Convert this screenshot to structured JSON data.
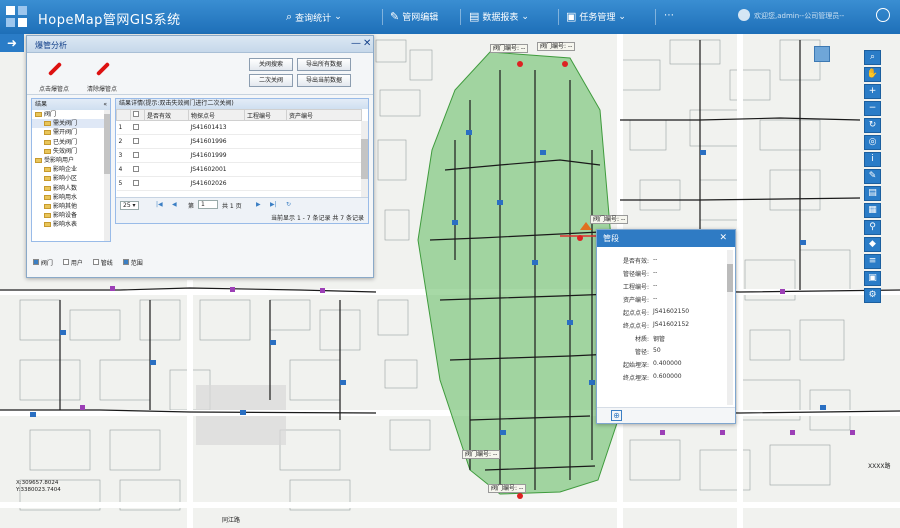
{
  "app": {
    "title": "HopeMap管网GIS系统"
  },
  "nav": [
    {
      "label": "查询统计",
      "icon": "search-icon",
      "dropdown": true
    },
    {
      "label": "管网编辑",
      "icon": "edit-icon",
      "dropdown": false
    },
    {
      "label": "数据报表",
      "icon": "report-icon",
      "dropdown": true
    },
    {
      "label": "任务管理",
      "icon": "task-icon",
      "dropdown": true
    }
  ],
  "user": {
    "text": "欢迎您,admin--公司管理员--"
  },
  "panel": {
    "title": "爆管分析",
    "tools": [
      "点击爆管点",
      "清除爆管点"
    ],
    "buttons": [
      "关阀搜索",
      "导出所有数据",
      "二次关阀",
      "导出当前数据"
    ],
    "tree": {
      "header": "结果",
      "items": [
        {
          "label": "阀门",
          "level": 0
        },
        {
          "label": "需关阀门",
          "level": 1
        },
        {
          "label": "需开阀门",
          "level": 1
        },
        {
          "label": "已关阀门",
          "level": 1
        },
        {
          "label": "失效阀门",
          "level": 1
        },
        {
          "label": "受影响用户",
          "level": 0
        },
        {
          "label": "影响企业",
          "level": 1
        },
        {
          "label": "影响小区",
          "level": 1
        },
        {
          "label": "影响人数",
          "level": 1
        },
        {
          "label": "影响用水",
          "level": 1
        },
        {
          "label": "影响其他",
          "level": 1
        },
        {
          "label": "影响设备",
          "level": 1
        },
        {
          "label": "影响水表",
          "level": 1
        }
      ]
    },
    "grid": {
      "title": "结果详情(提示:双击失效阀门进行二次关阀)",
      "columns": [
        "",
        "",
        "是否有效",
        "物探点号",
        "工程编号",
        "资产编号"
      ],
      "rows": [
        {
          "num": "1",
          "point": "JS41601413"
        },
        {
          "num": "2",
          "point": "JS41601996"
        },
        {
          "num": "3",
          "point": "JS41601999"
        },
        {
          "num": "4",
          "point": "JS41602001"
        },
        {
          "num": "5",
          "point": "JS41602026"
        }
      ],
      "pager": {
        "page_size": "25",
        "page_label": "第",
        "page": "1",
        "total_pages": "共 1 页",
        "info": "当前显示 1 - 7 条记录 共 7 条记录"
      }
    },
    "legend": [
      "阀门",
      "用户",
      "管线",
      "范围"
    ]
  },
  "popup": {
    "title": "管段",
    "rows": [
      {
        "k": "是否有效:",
        "v": "--"
      },
      {
        "k": "管径编号:",
        "v": "--"
      },
      {
        "k": "工程编号:",
        "v": "--"
      },
      {
        "k": "资产编号:",
        "v": "--"
      },
      {
        "k": "起点点号:",
        "v": "JS41602150"
      },
      {
        "k": "终点点号:",
        "v": "JS41602152"
      },
      {
        "k": "材质:",
        "v": "钢管"
      },
      {
        "k": "管径:",
        "v": "50"
      },
      {
        "k": "起始埋深:",
        "v": "0.400000"
      },
      {
        "k": "终点埋深:",
        "v": "0.600000"
      }
    ]
  },
  "map": {
    "tags": [
      "阀门编号: --",
      "阀门编号: --",
      "阀门编号: --",
      "阀门编号: --",
      "阀门编号: --"
    ],
    "coord": "X:309657.8024\nY:3380023.7404",
    "labels": [
      "同江路",
      "XXXX路"
    ]
  },
  "right_toolbar": [
    "zoom-in-icon",
    "pan-icon",
    "plus-icon",
    "minus-icon",
    "refresh-icon",
    "locate-icon",
    "info-icon",
    "measure-icon",
    "print-icon",
    "layer-icon",
    "marker-icon",
    "tag-icon",
    "list-icon",
    "table-icon",
    "settings-icon"
  ],
  "colors": {
    "accent": "#2a7cc7",
    "buffer": "#6cc06a",
    "pipe": "#1a1a1a"
  }
}
